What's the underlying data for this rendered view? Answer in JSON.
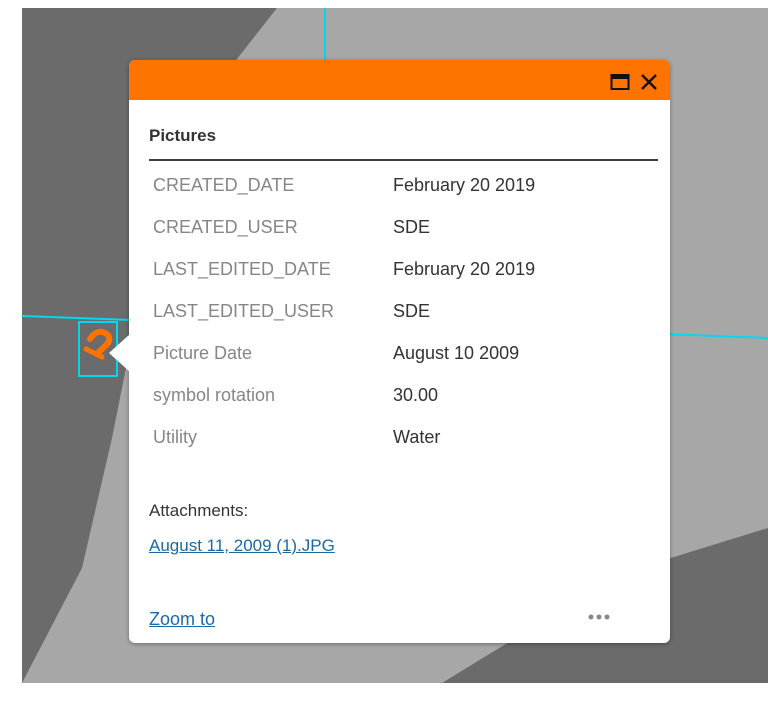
{
  "popup": {
    "title": "Pictures",
    "accent_color": "#ff7300",
    "icons": {
      "maximize": "maximize-icon",
      "close": "close-icon",
      "more": "more-dots-icon"
    },
    "attributes": [
      {
        "label": "CREATED_DATE",
        "value": "February 20 2019"
      },
      {
        "label": "CREATED_USER",
        "value": "SDE"
      },
      {
        "label": "LAST_EDITED_DATE",
        "value": "February 20 2019"
      },
      {
        "label": "LAST_EDITED_USER",
        "value": "SDE"
      },
      {
        "label": "Picture Date",
        "value": "August 10 2009"
      },
      {
        "label": "symbol rotation",
        "value": "30.00"
      },
      {
        "label": "Utility",
        "value": "Water"
      }
    ],
    "attachments_label": "Attachments:",
    "attachment_name": "August 11, 2009 (1).JPG",
    "zoom_label": "Zoom to"
  },
  "map": {
    "feature_color": "#ff7300",
    "selection_color": "#00d8f0",
    "marker_icon": "picture-marker-icon"
  }
}
